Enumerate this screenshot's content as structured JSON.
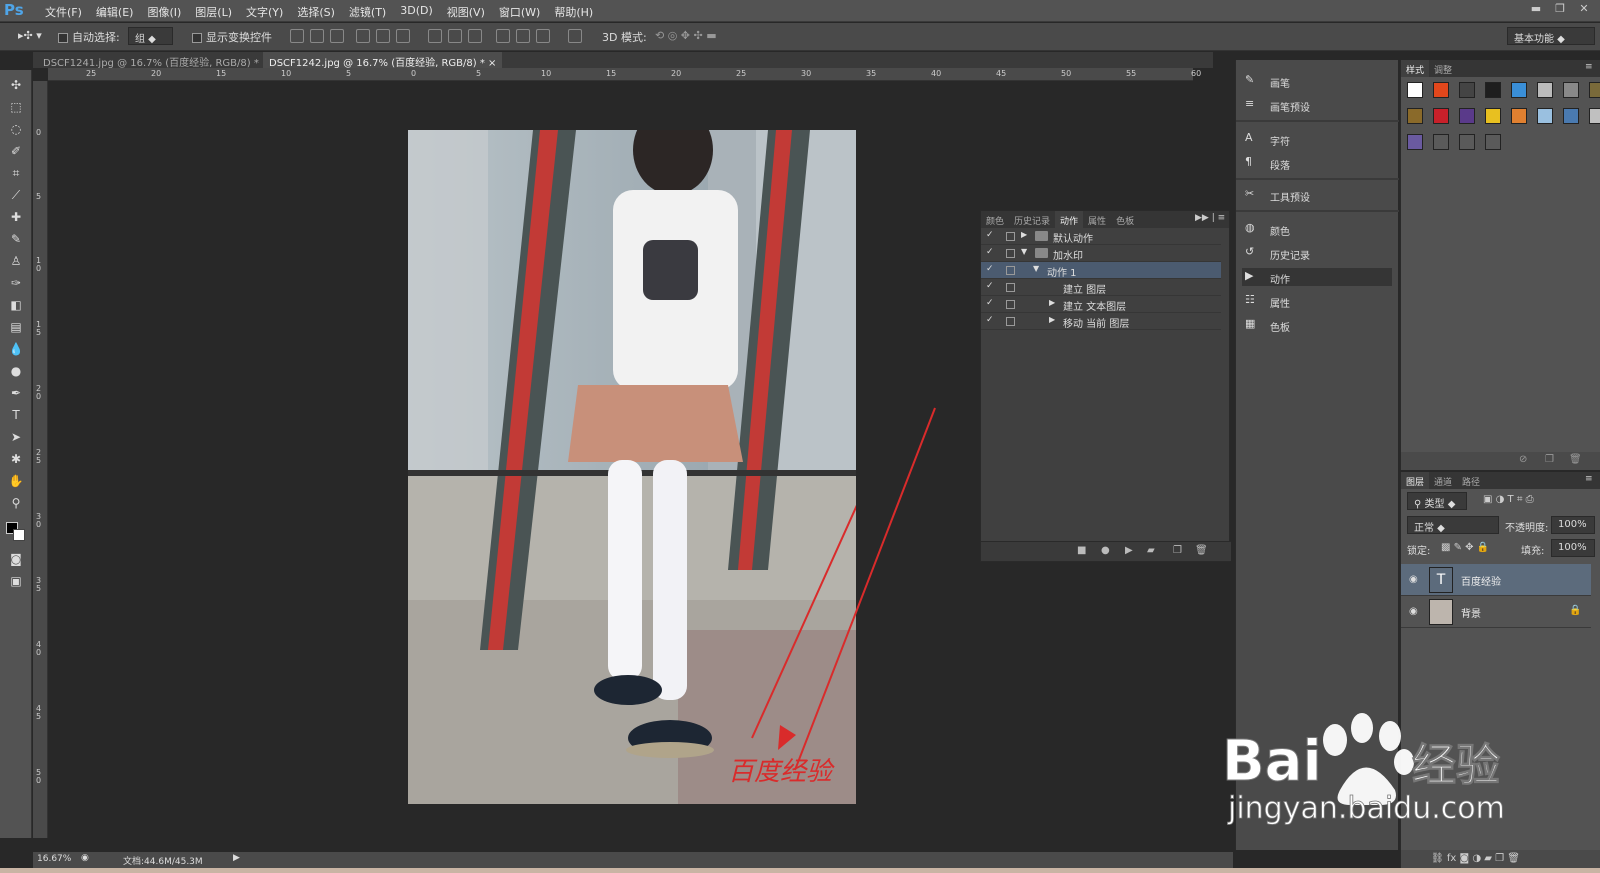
{
  "app": {
    "logo": "Ps"
  },
  "menu": [
    "文件(F)",
    "编辑(E)",
    "图像(I)",
    "图层(L)",
    "文字(Y)",
    "选择(S)",
    "滤镜(T)",
    "3D(D)",
    "视图(V)",
    "窗口(W)",
    "帮助(H)"
  ],
  "options": {
    "auto_select_label": "自动选择:",
    "auto_select_value": "组",
    "show_transform_label": "显示变换控件",
    "mode3d_label": "3D 模式:",
    "workspace": "基本功能"
  },
  "tabs": [
    {
      "label": "DSCF1241.jpg @ 16.7% (百度经验, RGB/8) *",
      "close": "×"
    },
    {
      "label": "DSCF1242.jpg @ 16.7% (百度经验, RGB/8) *",
      "close": "×"
    }
  ],
  "ruler_top": [
    "25",
    "20",
    "15",
    "10",
    "5",
    "0",
    "5",
    "10",
    "15",
    "20",
    "25",
    "30",
    "35",
    "40",
    "45",
    "50",
    "55",
    "60"
  ],
  "ruler_left": [
    "0",
    "5",
    "1 0",
    "1 5",
    "2 0",
    "2 5",
    "3 0",
    "3 5",
    "4 0",
    "4 5",
    "5 0"
  ],
  "watermark_text": "百度经验",
  "actions_panel": {
    "tabs": [
      "颜色",
      "历史记录",
      "动作",
      "属性",
      "色板"
    ],
    "active_tab": "动作",
    "rows": [
      {
        "check": "✓",
        "tri": "▶",
        "folder": true,
        "label": "默认动作",
        "indent": 0
      },
      {
        "check": "✓",
        "tri": "▼",
        "folder": true,
        "label": "加水印",
        "indent": 0
      },
      {
        "check": "✓",
        "tri": "▼",
        "folder": false,
        "label": "动作 1",
        "indent": 1,
        "selected": true
      },
      {
        "check": "✓",
        "tri": "",
        "folder": false,
        "label": "建立 图层",
        "indent": 2
      },
      {
        "check": "✓",
        "tri": "▶",
        "folder": false,
        "label": "建立 文本图层",
        "indent": 2
      },
      {
        "check": "✓",
        "tri": "▶",
        "folder": false,
        "label": "移动 当前 图层",
        "indent": 2
      }
    ]
  },
  "dock": [
    {
      "icon": "brush-icon",
      "glyph": "✎",
      "label": "画笔"
    },
    {
      "icon": "brush-preset-icon",
      "glyph": "≡",
      "label": "画笔预设"
    },
    {
      "icon": "character-icon",
      "glyph": "A",
      "label": "字符"
    },
    {
      "icon": "paragraph-icon",
      "glyph": "¶",
      "label": "段落"
    },
    {
      "icon": "tool-preset-icon",
      "glyph": "✂",
      "label": "工具预设"
    },
    {
      "icon": "color-icon",
      "glyph": "◍",
      "label": "颜色"
    },
    {
      "icon": "history-icon",
      "glyph": "↺",
      "label": "历史记录"
    },
    {
      "icon": "actions-icon",
      "glyph": "▶",
      "label": "动作",
      "active": true
    },
    {
      "icon": "properties-icon",
      "glyph": "☷",
      "label": "属性"
    },
    {
      "icon": "swatches-icon",
      "glyph": "▦",
      "label": "色板"
    }
  ],
  "styles_panel": {
    "tabs": [
      "样式",
      "调整"
    ],
    "swatch_colors": [
      "#ffffff",
      "#e2471c",
      "#444444",
      "#1e1e1e",
      "#3a8fd8",
      "#bbbbbb",
      "#888888",
      "#7a6a3a",
      "#8a6a2a",
      "#c8202a",
      "#5a3a8a",
      "#e8c020",
      "#e08030",
      "#9ac0e0",
      "#4a7ab0",
      "#c0c0c0",
      "#6a5aa0",
      "#5a5a5a",
      "#5a5a5a",
      "#5a5a5a"
    ]
  },
  "layers_panel": {
    "tabs": [
      "图层",
      "通道",
      "路径"
    ],
    "filter_label": "类型",
    "blend_mode": "正常",
    "opacity_label": "不透明度:",
    "opacity_value": "100%",
    "lock_label": "锁定:",
    "fill_label": "填充:",
    "fill_value": "100%",
    "layers": [
      {
        "name": "百度经验",
        "type": "text",
        "selected": true
      },
      {
        "name": "背景",
        "type": "image",
        "locked": true
      }
    ]
  },
  "status": {
    "zoom": "16.67%",
    "doc": "文档:44.6M/45.3M"
  },
  "baidu_logo": {
    "brand": "Bai",
    "brand2": "经验",
    "url": "jingyan.baidu.com"
  },
  "colors": {
    "accent_red": "#d92b2b",
    "baidu_white": "#ffffff",
    "selection": "#4b5b70"
  }
}
